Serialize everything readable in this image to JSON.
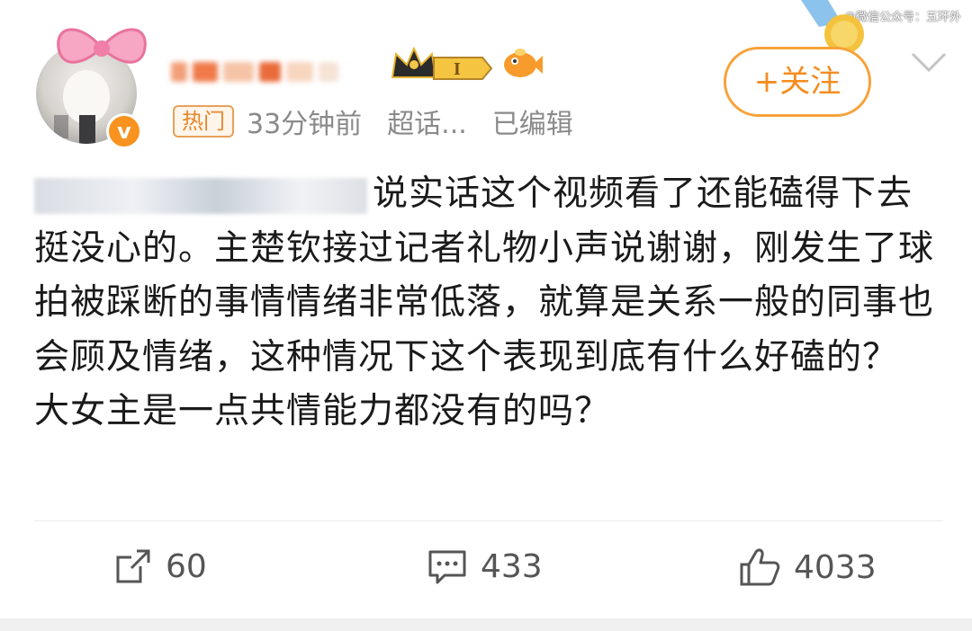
{
  "watermark": "@微信公众号：五环外",
  "post": {
    "meta": {
      "hot_tag": "热门",
      "time": "33分钟前",
      "topic": "超话...",
      "edited": "已编辑"
    },
    "follow_label": "+关注",
    "content": "说实话这个视频看了还能磕得下去挺没心的。主楚钦接过记者礼物小声说谢谢，刚发生了球拍被踩断的事情情绪非常低落，就算是关系一般的同事也会顾及情绪，这种情况下这个表现到底有什么好磕的？  大女主是一点共情能力都没有的吗？",
    "actions": {
      "repost_count": "60",
      "comment_count": "433",
      "like_count": "4033"
    }
  },
  "colors": {
    "accent_orange": "#f58c1f",
    "meta_gray": "#8a8a8a"
  },
  "icons": [
    "crown-vip-icon",
    "fish-badge-icon",
    "chevron-down-icon",
    "repost-icon",
    "comment-icon",
    "like-icon",
    "verified-icon"
  ]
}
